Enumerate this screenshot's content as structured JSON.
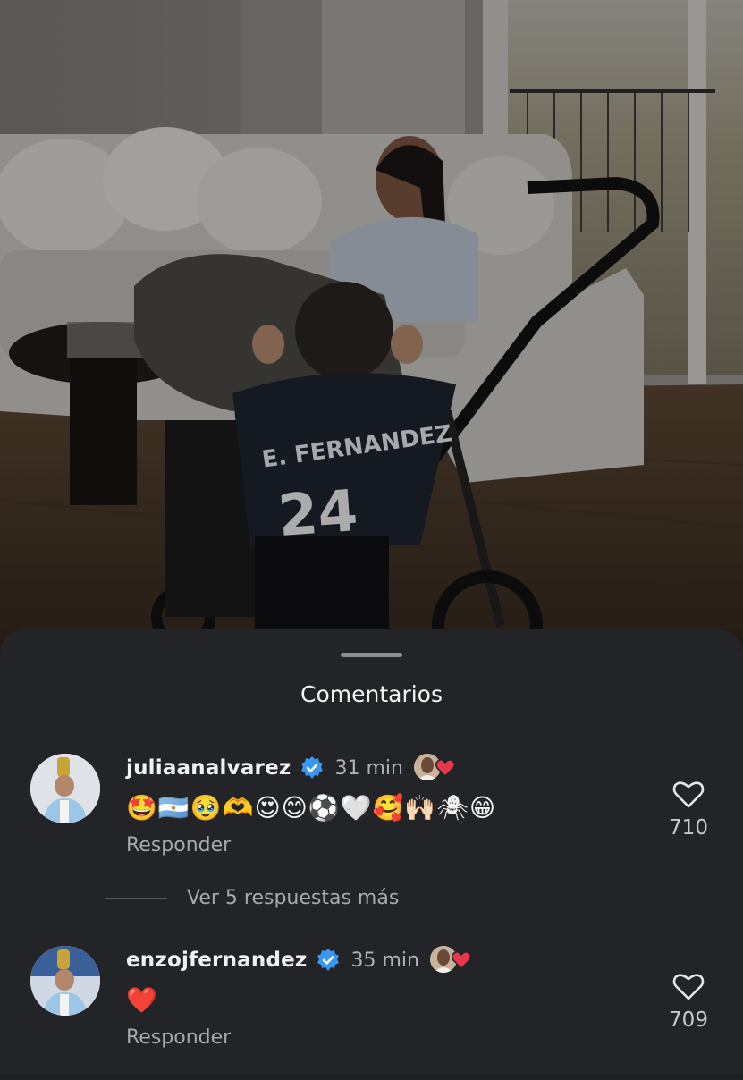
{
  "sheet": {
    "title": "Comentarios"
  },
  "comments": [
    {
      "username": "juliaanalvarez",
      "time": "31 min",
      "text": "🤩🇦🇷🥹🫶😍😊⚽🤍🥰🙌🏻🕷😁",
      "reply_label": "Responder",
      "likes": "710",
      "verified": true
    },
    {
      "username": "enzojfernandez",
      "time": "35 min",
      "text": "❤️",
      "reply_label": "Responder",
      "likes": "709",
      "verified": true
    }
  ],
  "more_replies": "Ver 5 respuestas más",
  "photo": {
    "jersey_name": "E. FERNANDEZ",
    "jersey_number": "24"
  },
  "colors": {
    "sheet_bg": "#232428",
    "verified_blue": "#3897f0",
    "heart_red": "#e8364a"
  }
}
